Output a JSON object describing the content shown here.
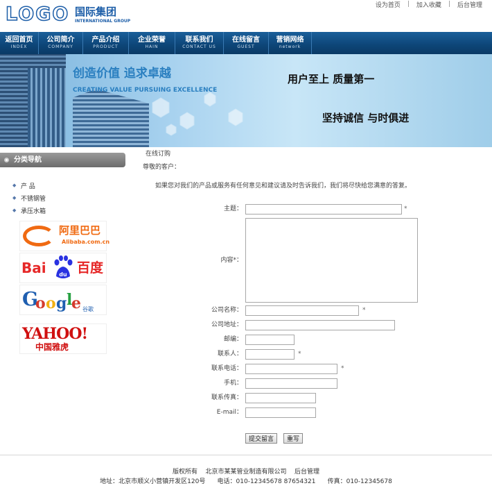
{
  "header": {
    "logo_text": "LOGO",
    "logo_cn": "国际集团",
    "logo_en": "INTERNATIONAL GROUP",
    "top_links": [
      "设为首页",
      "加入收藏",
      "后台管理"
    ]
  },
  "nav": [
    {
      "cn": "返回首页",
      "en": "INDEX"
    },
    {
      "cn": "公司简介",
      "en": "COMPANY"
    },
    {
      "cn": "产品介绍",
      "en": "PRODUCT"
    },
    {
      "cn": "企业荣誉",
      "en": "HAIN"
    },
    {
      "cn": "联系我们",
      "en": "CONTACT US"
    },
    {
      "cn": "在线留言",
      "en": "GUEST"
    },
    {
      "cn": "营销网络",
      "en": "network"
    }
  ],
  "banner": {
    "slogan_cn": "创造价值  追求卓越",
    "slogan_en": "CREATING VALUE PURSUING EXCELLENCE",
    "right_line1": "用户至上  质量第一",
    "right_line2": "坚持诚信  与时俱进"
  },
  "sidebar": {
    "title": "分类导航",
    "categories": [
      "产  品",
      "不锈钢管",
      "承压水箱"
    ],
    "partners": {
      "alibaba_cn": "阿里巴巴",
      "alibaba_en": "Alibaba.com.cn",
      "baidu_left": "Bai",
      "baidu_paw": "du",
      "baidu_right": "百度",
      "google": "Google",
      "google_cn": "谷歌",
      "yahoo": "YAHOO!",
      "yahoo_cn": "中国雅虎"
    }
  },
  "main": {
    "crumb": "在线订购",
    "greeting": "尊敬的客户：",
    "intro": "如果您对我们的产品或服务有任何意见和建议请及时告诉我们，我们将尽快给您满意的答复。",
    "fields": {
      "subject": "主题：",
      "content": "内容*：",
      "company": "公司名称：",
      "address": "公司地址：",
      "zip": "邮编：",
      "contact": "联系人：",
      "phone": "联系电话：",
      "mobile": "手机：",
      "fax": "联系传真：",
      "email": "E-mail："
    },
    "required_mark": "*",
    "submit_label": "提交留言",
    "reset_label": "重写"
  },
  "footer": {
    "copyright_label": "版权所有",
    "company": "北京市某某管业制造有限公司",
    "admin_link": "后台管理",
    "address": "地址：北京市顺义小营镇开发区120号",
    "phone": "电话：010-12345678 87654321",
    "fax": "传真：010-12345678"
  },
  "colors": {
    "brand": "#1d5ea8",
    "nav_bg": "#0d4577",
    "sidebar_head": "#7a7a7a"
  }
}
